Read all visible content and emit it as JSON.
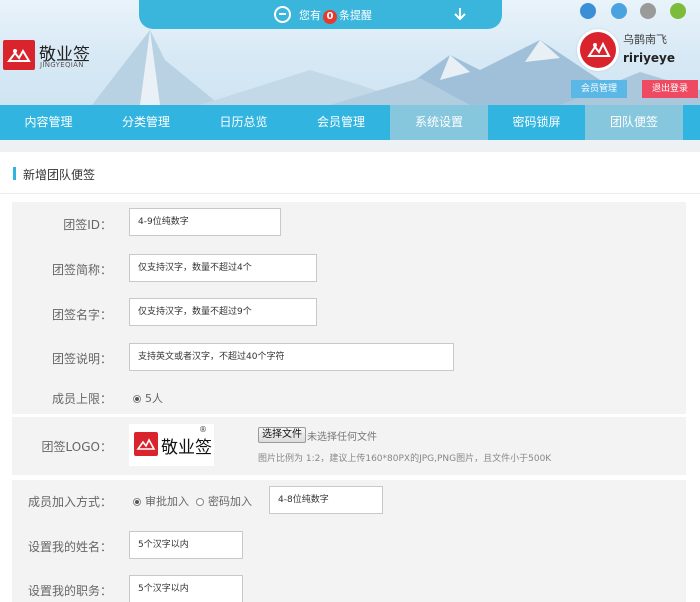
{
  "notice": {
    "prefix": "您有",
    "count": "0",
    "suffix": "条提醒"
  },
  "brand": {
    "title": "敬业签",
    "subtitle": "JINGYEQIAN"
  },
  "user": {
    "name_cn": "乌鹊南飞",
    "name_en": "ririyeye"
  },
  "header_buttons": {
    "member": "会员管理",
    "logout": "退出登录"
  },
  "browser_icons": [
    "ie-icon",
    "windows-icon",
    "apple-icon",
    "android-icon"
  ],
  "nav": {
    "items": [
      {
        "label": "内容管理",
        "active": false
      },
      {
        "label": "分类管理",
        "active": false
      },
      {
        "label": "日历总览",
        "active": false
      },
      {
        "label": "会员管理",
        "active": false
      },
      {
        "label": "系统设置",
        "active": true
      },
      {
        "label": "密码锁屏",
        "active": false
      },
      {
        "label": "团队便签",
        "active": true
      }
    ]
  },
  "panel": {
    "title": "新增团队便签"
  },
  "form": {
    "team_id": {
      "label": "团签ID：",
      "placeholder": "4-9位纯数字"
    },
    "team_short": {
      "label": "团签简称：",
      "placeholder": "仅支持汉字，数量不超过4个"
    },
    "team_name": {
      "label": "团签名字：",
      "placeholder": "仅支持汉字，数量不超过9个"
    },
    "team_desc": {
      "label": "团签说明：",
      "placeholder": "支持英文或者汉字，不超过40个字符"
    },
    "member_limit": {
      "label": "成员上限：",
      "option": "5人"
    },
    "team_logo": {
      "label": "团签LOGO：",
      "logo_text": "敬业签",
      "logo_mark": "®",
      "file_button": "选择文件",
      "file_status": "未选择任何文件",
      "hint": "图片比例为 1:2，建议上传160*80PX的JPG,PNG图片，且文件小于500K"
    },
    "join_mode": {
      "label": "成员加入方式：",
      "option_approve": "审批加入",
      "option_password": "密码加入",
      "password_placeholder": "4-8位纯数字"
    },
    "my_name": {
      "label": "设置我的姓名：",
      "placeholder": "5个汉字以内"
    },
    "my_role": {
      "label": "设置我的职务：",
      "placeholder": "5个汉字以内"
    }
  },
  "colors": {
    "nav": "#31b5e0",
    "nav_active": "#86c7de",
    "brand_red": "#d9232d",
    "logout": "#ee4a62",
    "member": "#5bb7e5"
  }
}
